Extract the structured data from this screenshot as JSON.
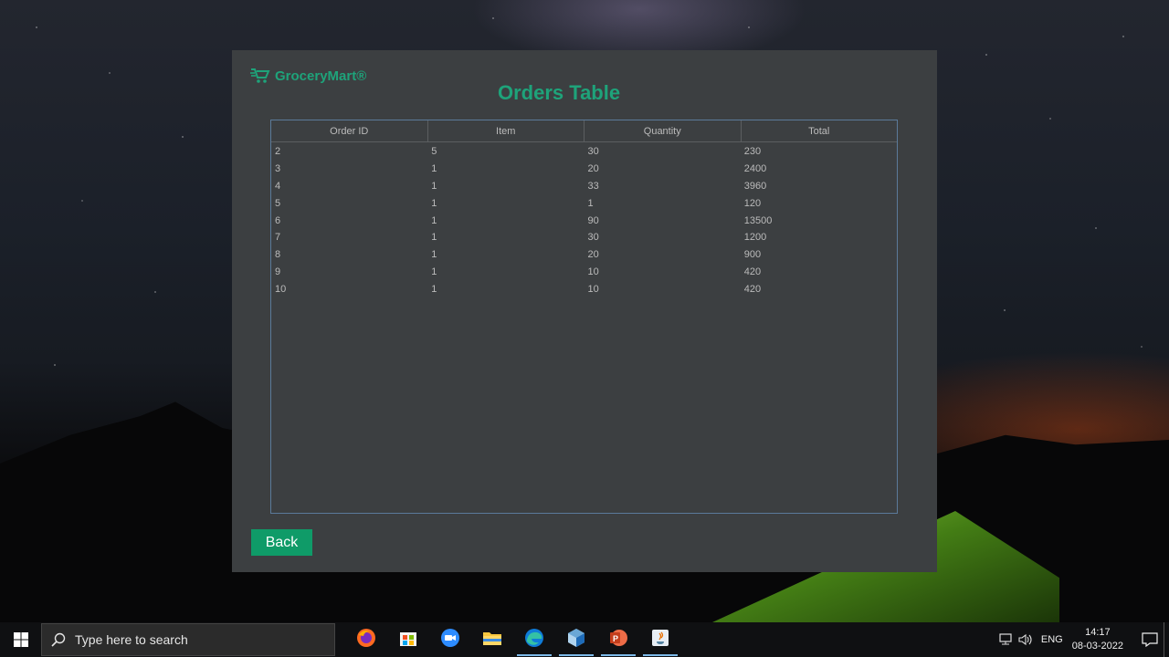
{
  "app": {
    "brand": "GroceryMart®",
    "title": "Orders Table"
  },
  "table": {
    "columns": [
      "Order ID",
      "Item",
      "Quantity",
      "Total"
    ],
    "rows": [
      [
        "2",
        "5",
        "30",
        "230"
      ],
      [
        "3",
        "1",
        "20",
        "2400"
      ],
      [
        "4",
        "1",
        "33",
        "3960"
      ],
      [
        "5",
        "1",
        "1",
        "120"
      ],
      [
        "6",
        "1",
        "90",
        "13500"
      ],
      [
        "7",
        "1",
        "30",
        "1200"
      ],
      [
        "8",
        "1",
        "20",
        "900"
      ],
      [
        "9",
        "1",
        "10",
        "420"
      ],
      [
        "10",
        "1",
        "10",
        "420"
      ]
    ]
  },
  "buttons": {
    "back": "Back"
  },
  "taskbar": {
    "search_placeholder": "Type here to search",
    "apps": [
      {
        "name": "firefox-icon",
        "active": false
      },
      {
        "name": "store-icon",
        "active": false
      },
      {
        "name": "zoom-icon",
        "active": false
      },
      {
        "name": "file-explorer-icon",
        "active": false
      },
      {
        "name": "edge-icon",
        "active": true
      },
      {
        "name": "netbeans-icon",
        "active": true
      },
      {
        "name": "powerpoint-icon",
        "active": true
      },
      {
        "name": "java-icon",
        "active": true
      }
    ],
    "language": "ENG",
    "time": "14:17",
    "date": "08-03-2022"
  },
  "colors": {
    "accent": "#1ea37a",
    "button": "#0f9b68",
    "window_bg": "#3c3f41",
    "table_border": "#5b7a9a",
    "text": "#bbbbbb"
  }
}
